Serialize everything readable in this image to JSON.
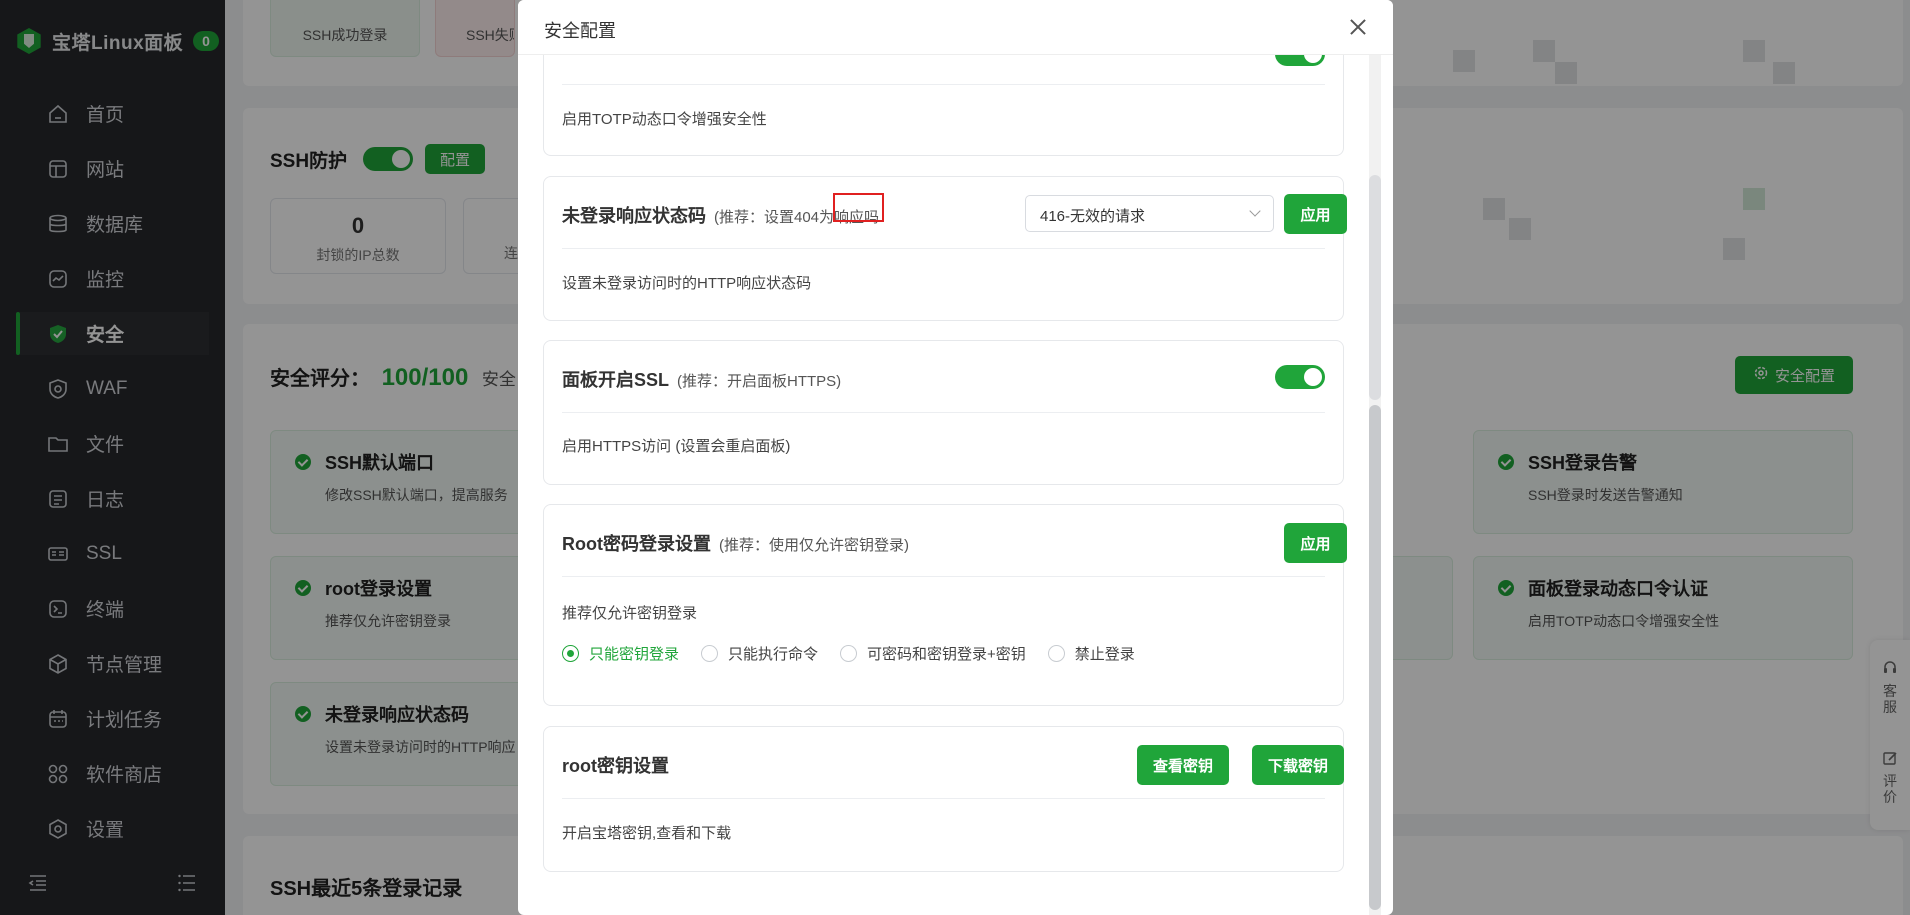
{
  "sidebar": {
    "brand": "宝塔Linux面板",
    "badge": "0",
    "items": [
      {
        "label": "首页",
        "icon": "home-icon"
      },
      {
        "label": "网站",
        "icon": "website-icon"
      },
      {
        "label": "数据库",
        "icon": "database-icon"
      },
      {
        "label": "监控",
        "icon": "monitor-icon"
      },
      {
        "label": "安全",
        "icon": "shield-icon",
        "active": true
      },
      {
        "label": "WAF",
        "icon": "waf-icon"
      },
      {
        "label": "文件",
        "icon": "folder-icon"
      },
      {
        "label": "日志",
        "icon": "log-icon"
      },
      {
        "label": "SSL",
        "icon": "ssl-icon"
      },
      {
        "label": "终端",
        "icon": "terminal-icon"
      },
      {
        "label": "节点管理",
        "icon": "node-icon"
      },
      {
        "label": "计划任务",
        "icon": "calendar-icon"
      },
      {
        "label": "软件商店",
        "icon": "store-icon"
      },
      {
        "label": "设置",
        "icon": "gear-icon"
      }
    ]
  },
  "background": {
    "ssh_success_login": "SSH成功登录",
    "ssh_fail_login": "SSH失败",
    "ssh_protect_title": "SSH防护",
    "ssh_protect_config": "配置",
    "blocked_ip_value": "0",
    "blocked_ip_label": "封锁的IP总数",
    "second_stat_label": "连",
    "score_label": "安全评分：",
    "score_value": "100/100",
    "score_suffix": "安全",
    "security_config_button": "安全配置",
    "tiles": [
      {
        "title": "SSH默认端口",
        "desc": "修改SSH默认端口，提高服务"
      },
      {
        "title": "root登录设置",
        "desc": "推荐仅允许密钥登录"
      },
      {
        "title": "未登录响应状态码",
        "desc": "设置未登录访问时的HTTP响应"
      },
      {
        "title": "SSH登录告警",
        "desc": "SSH登录时发送告警通知"
      },
      {
        "title": "面板登录动态口令认证",
        "desc": "启用TOTP动态口令增强安全性"
      }
    ],
    "recent_logins_title": "SSH最近5条登录记录"
  },
  "modal": {
    "title": "安全配置",
    "sections": {
      "totp": {
        "desc": "启用TOTP动态口令增强安全性"
      },
      "status_code": {
        "title": "未登录响应状态码",
        "hint_prefix": "(推荐：设置404为",
        "hint_highlight": "响应吗",
        "select_value": "416-无效的请求",
        "apply": "应用",
        "desc": "设置未登录访问时的HTTP响应状态码"
      },
      "ssl": {
        "title": "面板开启SSL",
        "hint": "(推荐：开启面板HTTPS)",
        "desc": "启用HTTPS访问 (设置会重启面板)"
      },
      "root_login": {
        "title": "Root密码登录设置",
        "hint": "(推荐：使用仅允许密钥登录)",
        "apply": "应用",
        "desc": "推荐仅允许密钥登录",
        "options": [
          "只能密钥登录",
          "只能执行命令",
          "可密码和密钥登录+密钥",
          "禁止登录"
        ],
        "selected": "只能密钥登录"
      },
      "root_key": {
        "title": "root密钥设置",
        "view_key": "查看密钥",
        "download_key": "下载密钥",
        "desc": "开启宝塔密钥,查看和下载"
      }
    }
  },
  "float_bar": {
    "service": "客服",
    "review": "评价"
  },
  "colors": {
    "accent": "#20a53a",
    "sidebar_bg": "#27292c",
    "highlight_border": "#e02020"
  }
}
